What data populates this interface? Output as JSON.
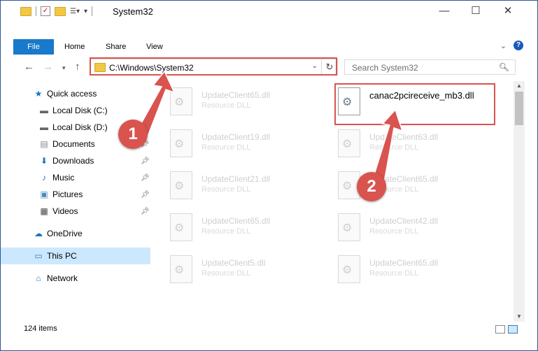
{
  "window": {
    "title": "System32",
    "controls": {
      "minimize": "—",
      "maximize": "☐",
      "close": "✕"
    }
  },
  "ribbon": {
    "tabs": [
      {
        "label": "File",
        "active": true
      },
      {
        "label": "Home"
      },
      {
        "label": "Share"
      },
      {
        "label": "View"
      }
    ]
  },
  "navigation": {
    "address": "C:\\Windows\\System32",
    "search_placeholder": "Search System32"
  },
  "sidebar": {
    "items": [
      {
        "label": "Quick access",
        "icon": "star-icon"
      },
      {
        "label": "Local Disk (C:)",
        "icon": "drive-icon"
      },
      {
        "label": "Local Disk (D:)",
        "icon": "drive-icon"
      },
      {
        "label": "Documents",
        "icon": "documents-icon"
      },
      {
        "label": "Downloads",
        "icon": "download-icon"
      },
      {
        "label": "Music",
        "icon": "music-icon"
      },
      {
        "label": "Pictures",
        "icon": "pictures-icon"
      },
      {
        "label": "Videos",
        "icon": "videos-icon"
      },
      {
        "label": "OneDrive",
        "icon": "cloud-icon"
      },
      {
        "label": "This PC",
        "icon": "computer-icon",
        "selected": true
      },
      {
        "label": "Network",
        "icon": "network-icon"
      }
    ]
  },
  "files": {
    "left_column": [
      {
        "name": "UpdateClient65.dll",
        "type": "Resource DLL"
      },
      {
        "name": "UpdateClient19.dll",
        "type": "Resource DLL"
      },
      {
        "name": "UpdateClient21.dll",
        "type": "Resource DLL"
      },
      {
        "name": "UpdateClient65.dll",
        "type": "Resource DLL"
      },
      {
        "name": "UpdateClient5.dll",
        "type": "Resource DLL"
      }
    ],
    "right_column": [
      {
        "name": "canac2pcireceive_mb3.dll",
        "type": "",
        "active": true
      },
      {
        "name": "UpdateClient63.dll",
        "type": "Resource DLL"
      },
      {
        "name": "UpdateClient65.dll",
        "type": "Resource DLL"
      },
      {
        "name": "UpdateClient42.dll",
        "type": "Resource DLL"
      },
      {
        "name": "UpdateClient65.dll",
        "type": "Resource DLL"
      }
    ]
  },
  "status": {
    "item_count": "124 items"
  },
  "annotations": {
    "step1": "1",
    "step2": "2",
    "color": "#d9534f"
  }
}
